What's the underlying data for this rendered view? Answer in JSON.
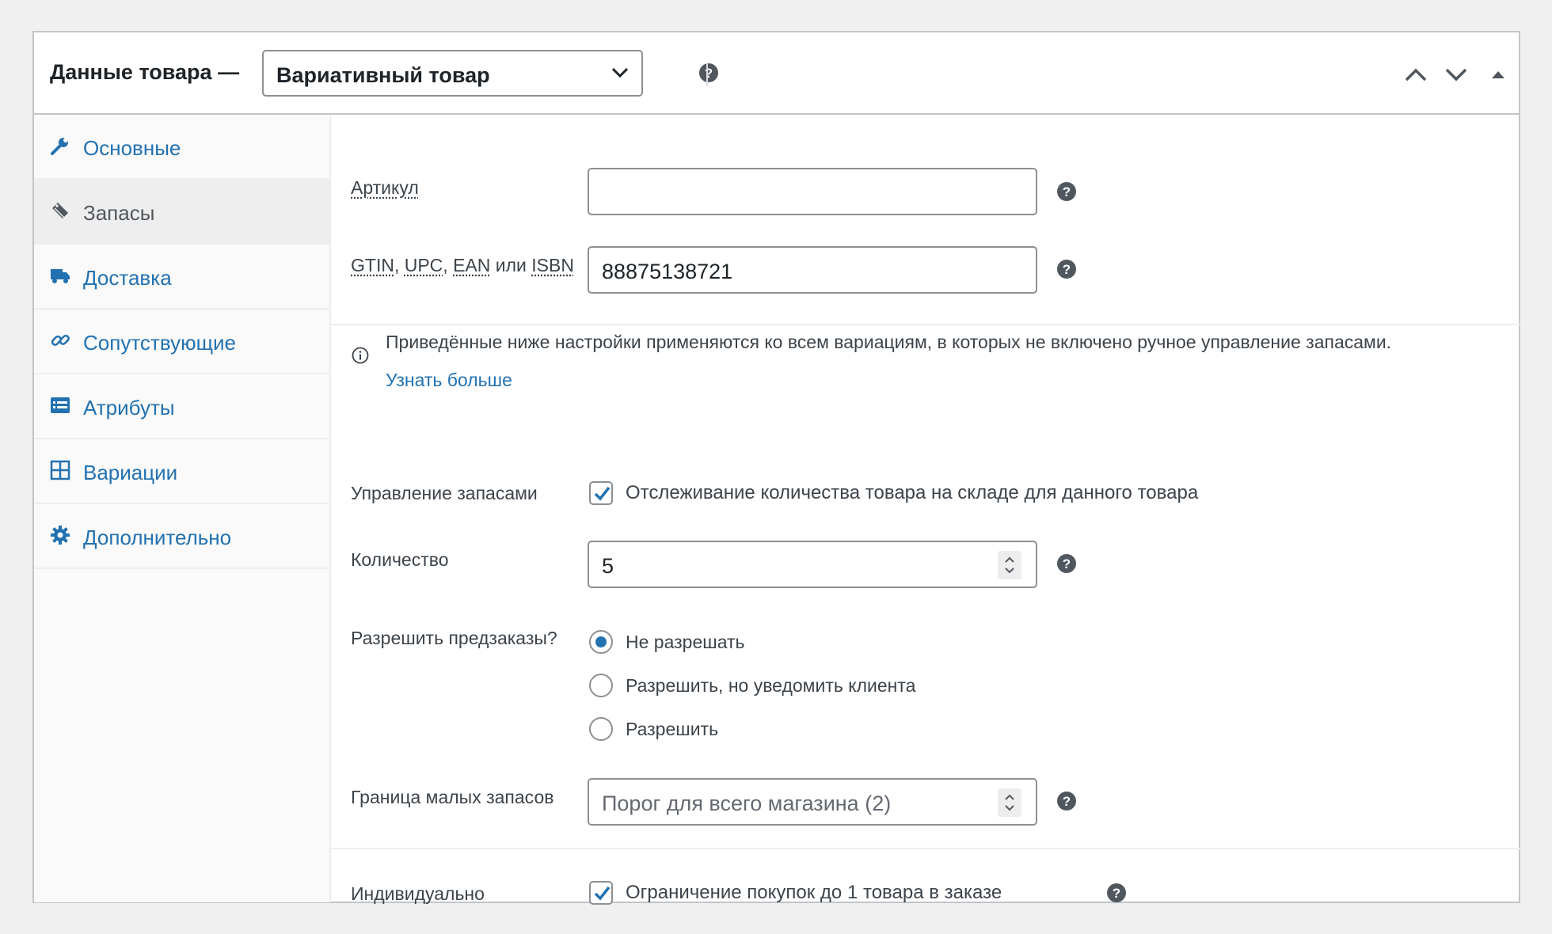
{
  "header": {
    "title": "Данные товара —",
    "product_type": "Вариативный товар"
  },
  "sidebar": {
    "items": [
      {
        "label": "Основные",
        "icon": "wrench-icon"
      },
      {
        "label": "Запасы",
        "icon": "tag-icon",
        "active": true
      },
      {
        "label": "Доставка",
        "icon": "truck-icon"
      },
      {
        "label": "Сопутствующие",
        "icon": "link-icon"
      },
      {
        "label": "Атрибуты",
        "icon": "list-icon"
      },
      {
        "label": "Вариации",
        "icon": "grid-icon"
      },
      {
        "label": "Дополнительно",
        "icon": "gear-icon"
      }
    ]
  },
  "inventory": {
    "sku_label": "Артикул",
    "sku_value": "",
    "gtin_label_parts": [
      "GTIN",
      "UPC",
      "EAN",
      "или",
      "ISBN"
    ],
    "gtin_value": "88875138721",
    "notice_text": "Приведённые ниже настройки применяются ко всем вариациям, в которых не включено ручное управление запасами.",
    "notice_link": "Узнать больше",
    "manage_stock_label": "Управление запасами",
    "manage_stock_text": "Отслеживание количества товара на складе для данного товара",
    "manage_stock_checked": true,
    "quantity_label": "Количество",
    "quantity_value": "5",
    "backorders_label": "Разрешить предзаказы?",
    "backorders_options": [
      {
        "label": "Не разрешать",
        "selected": true
      },
      {
        "label": "Разрешить, но уведомить клиента",
        "selected": false
      },
      {
        "label": "Разрешить",
        "selected": false
      }
    ],
    "low_stock_label": "Граница малых запасов",
    "low_stock_placeholder": "Порог для всего магазина (2)",
    "sold_individually_label": "Индивидуально",
    "sold_individually_text": "Ограничение покупок до 1 товара в заказе",
    "sold_individually_checked": true
  },
  "colors": {
    "link": "#2271b1",
    "text": "#1d2327",
    "muted": "#3c434a",
    "border": "#8c8f94",
    "page_bg": "#f0f0f1"
  }
}
